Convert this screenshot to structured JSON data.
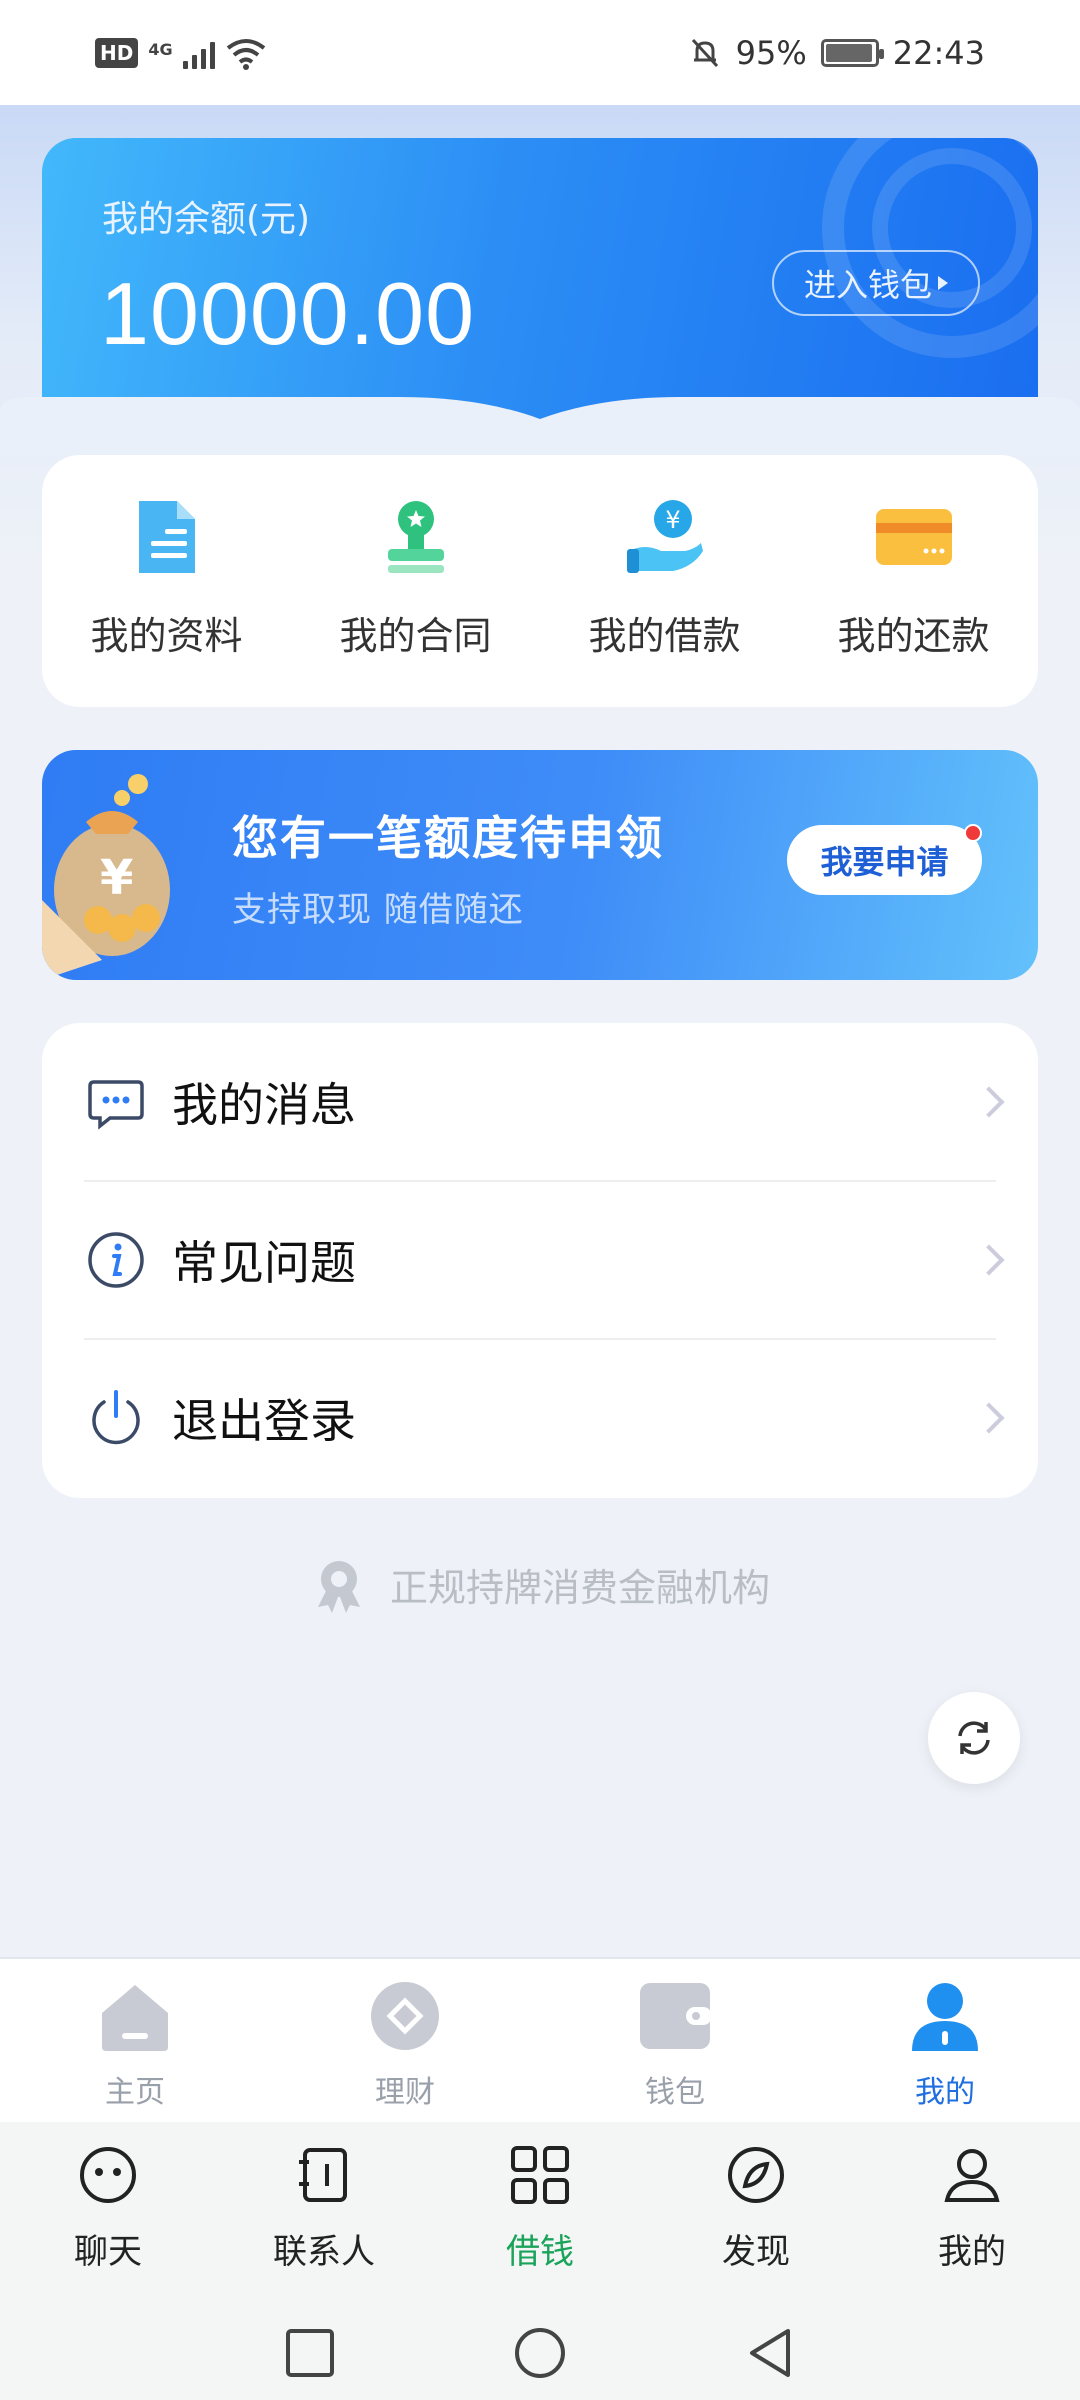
{
  "status_bar": {
    "network_badge": "HD",
    "network_type": "4G",
    "battery_percent": "95%",
    "time": "22:43",
    "icons": [
      "hd-icon",
      "signal-icon",
      "wifi-icon",
      "mute-bell-icon",
      "battery-charging-icon"
    ]
  },
  "balance": {
    "label": "我的余额(元)",
    "value": "10000.00",
    "wallet_button": "进入钱包"
  },
  "quick_actions": [
    {
      "label": "我的资料",
      "icon": "document-icon"
    },
    {
      "label": "我的合同",
      "icon": "stamp-icon"
    },
    {
      "label": "我的借款",
      "icon": "money-hand-icon"
    },
    {
      "label": "我的还款",
      "icon": "card-icon"
    }
  ],
  "promo": {
    "title": "您有一笔额度待申领",
    "subtitle": "支持取现 随借随还",
    "button": "我要申请",
    "icon": "money-bag-icon",
    "currency_glyph": "¥"
  },
  "menu": [
    {
      "label": "我的消息",
      "icon": "message-icon"
    },
    {
      "label": "常见问题",
      "icon": "info-icon"
    },
    {
      "label": "退出登录",
      "icon": "power-icon"
    }
  ],
  "license_text": "正规持牌消费金融机构",
  "app_tabs": [
    {
      "label": "主页",
      "icon": "home-icon",
      "active": false
    },
    {
      "label": "理财",
      "icon": "finance-icon",
      "active": false
    },
    {
      "label": "钱包",
      "icon": "wallet-icon",
      "active": false
    },
    {
      "label": "我的",
      "icon": "user-icon",
      "active": true
    }
  ],
  "host_nav": [
    {
      "label": "聊天",
      "icon": "chat-icon",
      "active": false
    },
    {
      "label": "联系人",
      "icon": "contacts-icon",
      "active": false
    },
    {
      "label": "借钱",
      "icon": "grid-icon",
      "active": true
    },
    {
      "label": "发现",
      "icon": "compass-icon",
      "active": false
    },
    {
      "label": "我的",
      "icon": "person-icon",
      "active": false
    }
  ],
  "colors": {
    "accent_blue": "#1f6fe0",
    "host_active_green": "#1aa35a",
    "promo_dot_red": "#f03a3a"
  }
}
